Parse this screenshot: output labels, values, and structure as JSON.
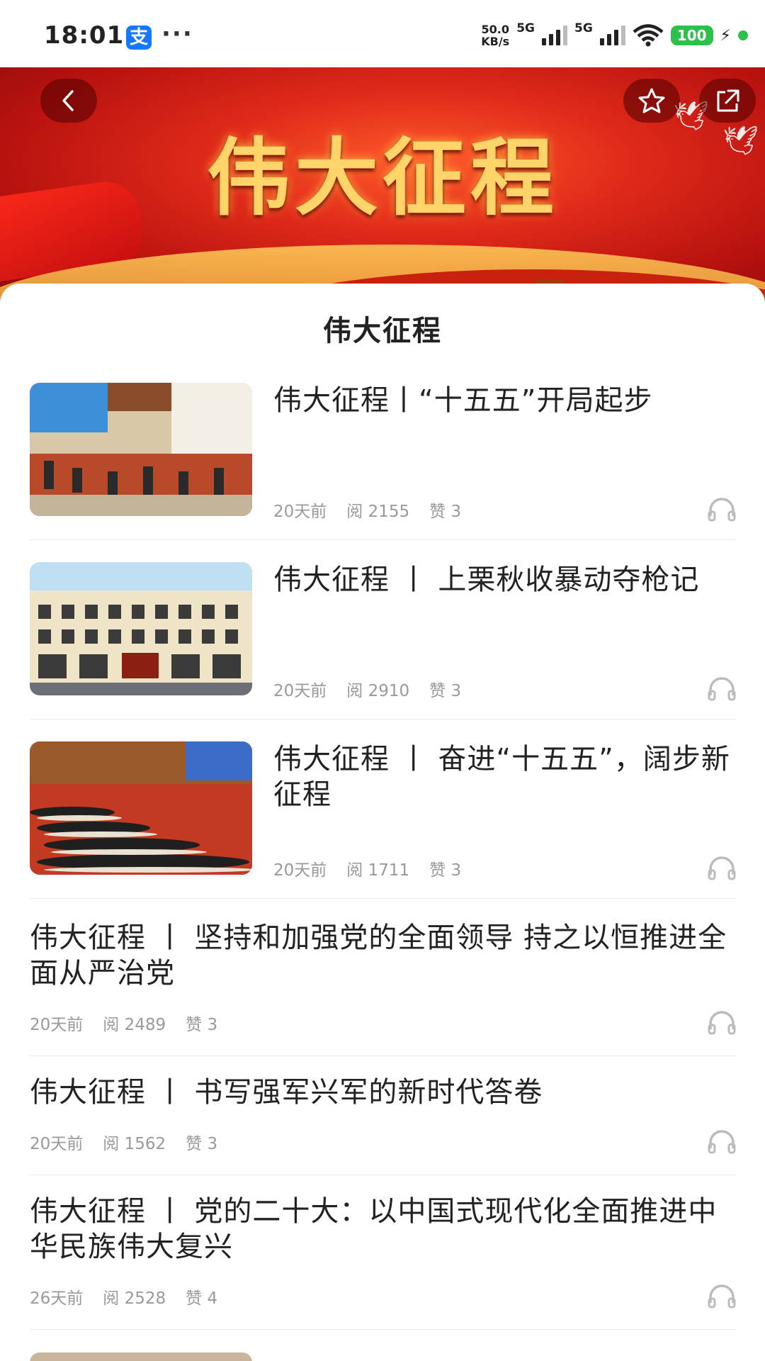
{
  "status_bar": {
    "time": "18:01",
    "alipay_icon": "支",
    "more": "···",
    "speed_value": "50.0",
    "speed_unit": "KB/s",
    "net1": "5G",
    "net2": "5G",
    "battery": "100"
  },
  "banner": {
    "title": "伟大征程"
  },
  "page": {
    "title": "伟大征程"
  },
  "articles": [
    {
      "title": "伟大征程丨“十五五”开局起步",
      "time": "20天前",
      "reads": "阅 2155",
      "likes": "赞 3"
    },
    {
      "title": "伟大征程 丨 上栗秋收暴动夺枪记",
      "time": "20天前",
      "reads": "阅 2910",
      "likes": "赞 3"
    },
    {
      "title": "伟大征程 丨 奋进“十五五”，阔步新征程",
      "time": "20天前",
      "reads": "阅 1711",
      "likes": "赞 3"
    },
    {
      "title": "伟大征程 丨 坚持和加强党的全面领导 持之以恒推进全面从严治党",
      "time": "20天前",
      "reads": "阅 2489",
      "likes": "赞 3"
    },
    {
      "title": "伟大征程 丨 书写强军兴军的新时代答卷",
      "time": "20天前",
      "reads": "阅 1562",
      "likes": "赞 3"
    },
    {
      "title": "伟大征程 丨 党的二十大：以中国式现代化全面推进中华民族伟大复兴",
      "time": "26天前",
      "reads": "阅 2528",
      "likes": "赞 4"
    }
  ]
}
